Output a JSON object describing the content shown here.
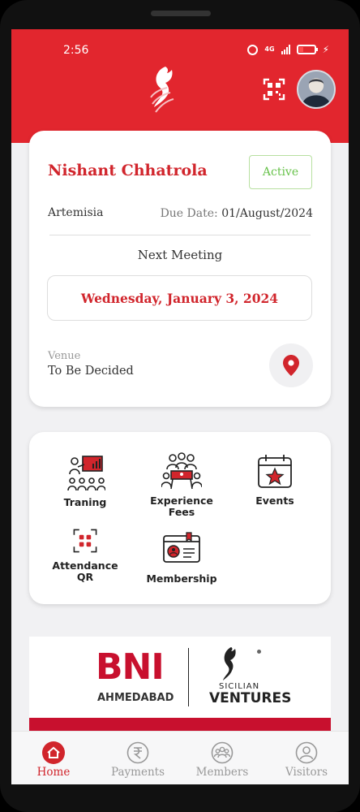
{
  "status_bar": {
    "time": "2:56",
    "network": "4G"
  },
  "header": {
    "logo_icon": "horse-logo-icon",
    "qr_icon": "qr-scan-icon",
    "avatar_icon": "user-avatar"
  },
  "member": {
    "name": "Nishant Chhatrola",
    "status": "Active",
    "chapter": "Artemisia",
    "due_label": "Due Date:",
    "due_value": "01/August/2024",
    "next_meeting_title": "Next Meeting",
    "next_meeting_date": "Wednesday, January 3, 2024",
    "venue_label": "Venue",
    "venue_value": "To Be Decided"
  },
  "menu": {
    "items": [
      {
        "label": "Traning",
        "icon": "training-icon"
      },
      {
        "label": "Experience\nFees",
        "icon": "experience-fees-icon"
      },
      {
        "label": "Events",
        "icon": "calendar-star-icon"
      },
      {
        "label": "Attendance\nQR",
        "icon": "attendance-qr-icon"
      },
      {
        "label": "Membership",
        "icon": "membership-card-icon"
      }
    ]
  },
  "banner": {
    "brand": "BNI",
    "city": "AHMEDABAD",
    "partner_line1": "SICILIAN",
    "partner_line2": "VENTURES"
  },
  "nav": {
    "items": [
      {
        "label": "Home",
        "icon": "home-icon",
        "active": true
      },
      {
        "label": "Payments",
        "icon": "rupee-icon",
        "active": false
      },
      {
        "label": "Members",
        "icon": "members-icon",
        "active": false
      },
      {
        "label": "Visitors",
        "icon": "visitor-icon",
        "active": false
      }
    ]
  },
  "colors": {
    "brand_red": "#e2262e",
    "accent_red": "#d1252c",
    "active_green": "#67c24a"
  }
}
